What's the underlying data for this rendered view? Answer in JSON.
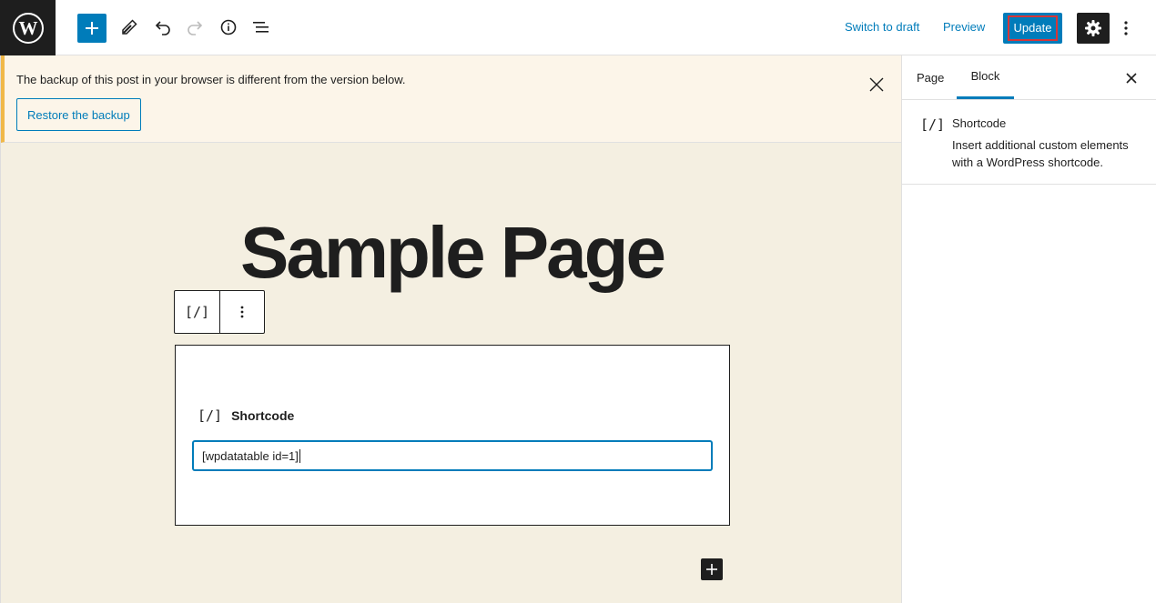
{
  "toolbar": {
    "add_label": "+",
    "switch_to_draft": "Switch to draft",
    "preview": "Preview",
    "update": "Update"
  },
  "notice": {
    "message": "The backup of this post in your browser is different from the version below.",
    "restore_button": "Restore the backup"
  },
  "editor": {
    "page_title": "Sample Page",
    "block_toolbar_icon": "[/]",
    "shortcode_block": {
      "icon": "[/]",
      "label": "Shortcode",
      "value": "[wpdatatable id=1]"
    }
  },
  "sidebar": {
    "tabs": [
      {
        "label": "Page",
        "active": false
      },
      {
        "label": "Block",
        "active": true
      }
    ],
    "block_card": {
      "icon": "[/]",
      "title": "Shortcode",
      "description": "Insert additional custom elements with a WordPress shortcode."
    }
  },
  "colors": {
    "accent": "#007cba",
    "editor_bg": "#f4efe1",
    "notice_bg": "#fcf5e9",
    "notice_border": "#f0b849",
    "highlight": "#d63638"
  },
  "icons": [
    "wordpress-logo-icon",
    "plus-icon",
    "pencil-icon",
    "undo-icon",
    "redo-icon",
    "info-icon",
    "list-view-icon",
    "gear-icon",
    "more-vertical-icon",
    "close-icon",
    "shortcode-icon"
  ]
}
